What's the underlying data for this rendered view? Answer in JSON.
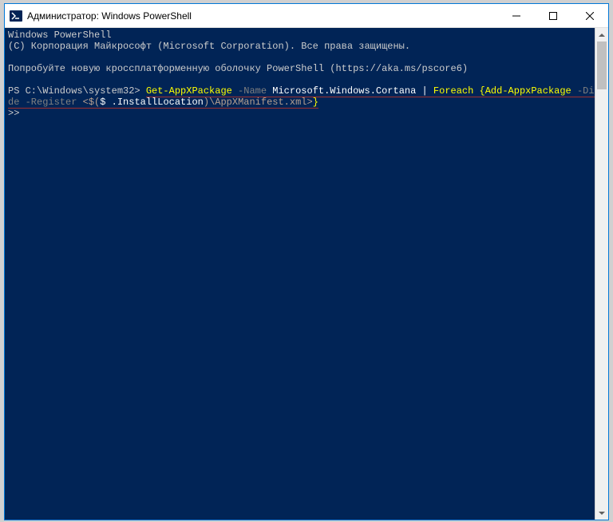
{
  "window": {
    "title": "Администратор: Windows PowerShell"
  },
  "terminal": {
    "header_line1": "Windows PowerShell",
    "header_line2": "(C) Корпорация Майкрософт (Microsoft Corporation). Все права защищены.",
    "banner": "Попробуйте новую кроссплатформенную оболочку PowerShell (https://aka.ms/pscore6)",
    "prompt": "PS C:\\Windows\\system32> ",
    "cmd": {
      "part1": "Get-AppXPackage",
      "part2": " -Name ",
      "part3": "Microsoft.Windows.Cortana ",
      "part4": "|",
      "part5": " Foreach ",
      "part6": "{",
      "part7": "Add-AppxPackage",
      "part8": " -DisableDevelopmentMo",
      "part9": "de -Register ",
      "part10": "<$(",
      "part11": "$ ",
      "part12": ".InstallLocation",
      "part13": ")",
      "part14": "\\AppXManifest.xml>",
      "part15": "}"
    },
    "continuation": ">>"
  }
}
